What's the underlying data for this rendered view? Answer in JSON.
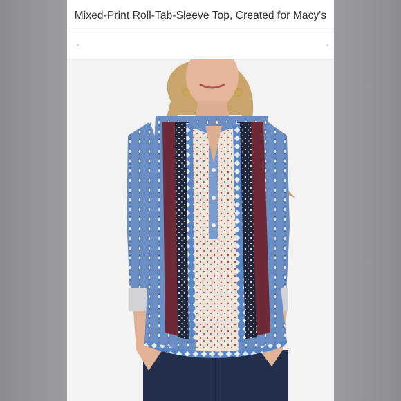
{
  "product": {
    "title": "Mixed-Print Roll-Tab-Sleeve Top, Created for Macy's",
    "image_icon": "product-photo"
  },
  "colors": {
    "page_bg": "#8d8f92",
    "sheet_bg": "#ffffff",
    "title_text": "#333333",
    "denim_blue": "#6b8fc4",
    "burgundy": "#6e2a36",
    "cream": "#efe2d6"
  }
}
